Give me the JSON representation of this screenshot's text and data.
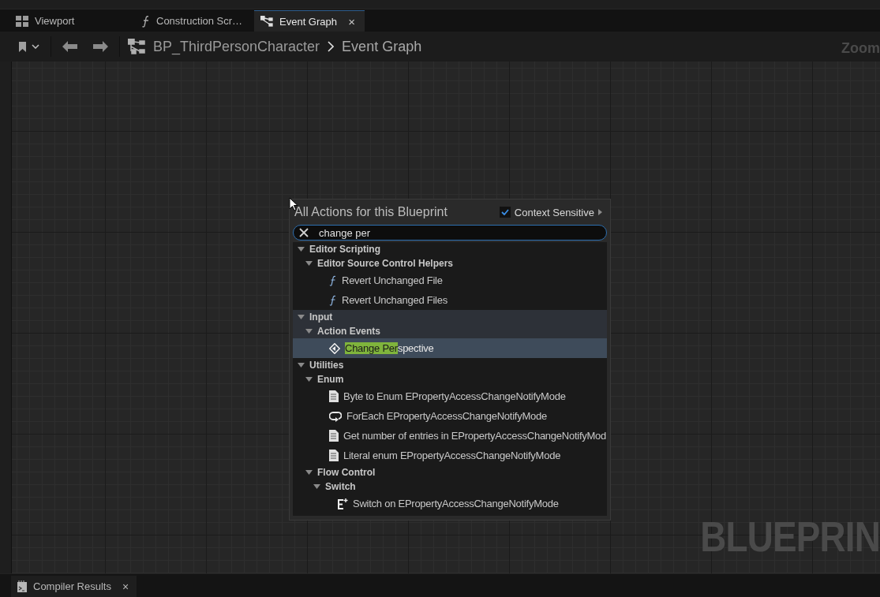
{
  "tabs": [
    {
      "label": "Viewport",
      "kind": "viewport",
      "selected": false
    },
    {
      "label": "Construction Scr…",
      "kind": "function",
      "selected": false
    },
    {
      "label": "Event Graph",
      "kind": "graph",
      "selected": true,
      "close": "×"
    }
  ],
  "breadcrumb": {
    "blueprint": "BP_ThirdPersonCharacter",
    "graph": "Event Graph"
  },
  "graph": {
    "zoom_label": "Zoom",
    "watermark": "BLUEPRIN"
  },
  "action_menu": {
    "title": "All Actions for this Blueprint",
    "context_sensitive": {
      "label": "Context Sensitive",
      "checked": true
    },
    "search": {
      "value": "change per"
    },
    "tree": [
      {
        "label": "Editor Scripting",
        "kind": "category",
        "expanded": true,
        "hovered": false,
        "children": [
          {
            "label": "Editor Source Control Helpers",
            "kind": "category",
            "expanded": true,
            "children": [
              {
                "label": "Revert Unchanged File",
                "kind": "function",
                "selected": false
              },
              {
                "label": "Revert Unchanged Files",
                "kind": "function",
                "selected": false
              }
            ]
          }
        ]
      },
      {
        "label": "Input",
        "kind": "category",
        "expanded": true,
        "hovered": true,
        "children": [
          {
            "label": "Action Events",
            "kind": "category",
            "expanded": true,
            "children": [
              {
                "label": "spective",
                "match": "Change Per",
                "kind": "event",
                "selected": true
              }
            ]
          }
        ]
      },
      {
        "label": "Utilities",
        "kind": "category",
        "expanded": true,
        "hovered": false,
        "children": [
          {
            "label": "Enum",
            "kind": "category",
            "expanded": true,
            "children": [
              {
                "label": "Byte to Enum EPropertyAccessChangeNotifyMode",
                "kind": "enum",
                "selected": false
              },
              {
                "label": "ForEach EPropertyAccessChangeNotifyMode",
                "kind": "loop",
                "selected": false
              },
              {
                "label": "Get number of entries in EPropertyAccessChangeNotifyMod",
                "kind": "enum",
                "selected": false
              },
              {
                "label": "Literal enum EPropertyAccessChangeNotifyMode",
                "kind": "enum",
                "selected": false
              }
            ]
          },
          {
            "label": "Flow Control",
            "kind": "category",
            "expanded": true,
            "children": [
              {
                "label": "Switch",
                "kind": "category",
                "expanded": true,
                "children": [
                  {
                    "label": "Switch on EPropertyAccessChangeNotifyMode",
                    "kind": "switch",
                    "selected": false
                  }
                ]
              }
            ]
          }
        ]
      }
    ]
  },
  "bottom_tabs": [
    {
      "label": "Compiler Results",
      "close": "×"
    }
  ]
}
